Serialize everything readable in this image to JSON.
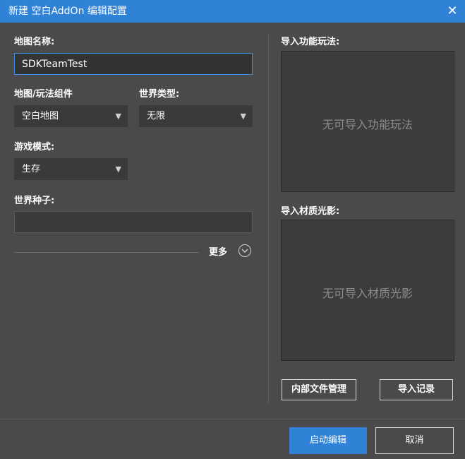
{
  "window": {
    "title": "新建 空白AddOn 编辑配置",
    "close_glyph": "✕"
  },
  "form": {
    "map_name": {
      "label": "地图名称:",
      "value": "SDKTeamTest"
    },
    "map_component": {
      "label": "地图/玩法组件",
      "selected": "空白地图"
    },
    "world_type": {
      "label": "世界类型:",
      "selected": "无限"
    },
    "game_mode": {
      "label": "游戏模式:",
      "selected": "生存"
    },
    "world_seed": {
      "label": "世界种子:",
      "value": ""
    },
    "more_label": "更多"
  },
  "right": {
    "gameplay": {
      "label": "导入功能玩法:",
      "empty_text": "无可导入功能玩法"
    },
    "shader": {
      "label": "导入材质光影:",
      "empty_text": "无可导入材质光影"
    },
    "internal_files_button": "内部文件管理",
    "import_log_button": "导入记录"
  },
  "footer": {
    "start_button": "启动编辑",
    "cancel_button": "取消"
  },
  "icons": {
    "dropdown": "▼",
    "close": "close-icon",
    "more": "chevron-down-icon"
  },
  "colors": {
    "accent": "#2f82d6",
    "background": "#4a4a4a",
    "field": "#3a3a3a",
    "panel": "#3c3c3c",
    "focus_border": "#3e8fe0"
  }
}
